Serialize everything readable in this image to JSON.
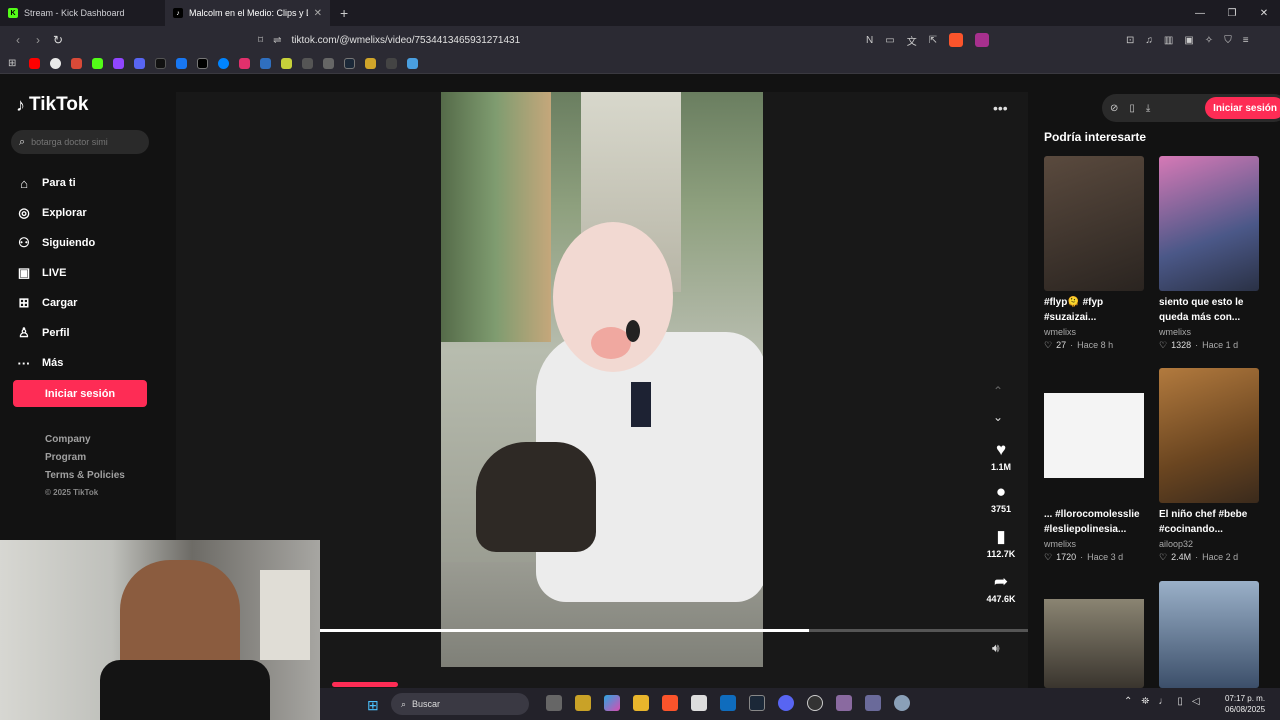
{
  "browser": {
    "tabs": [
      {
        "title": "Stream - Kick Dashboard",
        "favicon": "K",
        "favicon_color": "#53fc18"
      },
      {
        "title": "Malcolm en el Medio: Clips y Dr",
        "favicon": "♪",
        "favicon_color": "#000000"
      }
    ],
    "new_tab": "+",
    "url": "tiktok.com/@wmelixs/video/7534413465931271431"
  },
  "tiktok": {
    "logo": "TikTok",
    "search_placeholder": "botarga doctor simi",
    "nav": [
      {
        "label": "Para ti",
        "icon": "home-icon",
        "glyph": "⌂"
      },
      {
        "label": "Explorar",
        "icon": "compass-icon",
        "glyph": "◎"
      },
      {
        "label": "Siguiendo",
        "icon": "following-icon",
        "glyph": "⚇"
      },
      {
        "label": "LIVE",
        "icon": "live-icon",
        "glyph": "▣"
      },
      {
        "label": "Cargar",
        "icon": "upload-icon",
        "glyph": "⊞"
      },
      {
        "label": "Perfil",
        "icon": "profile-icon",
        "glyph": "♙"
      },
      {
        "label": "Más",
        "icon": "more-icon",
        "glyph": "···"
      }
    ],
    "login_label": "Iniciar sesión",
    "footer": {
      "company": "Company",
      "program": "Program",
      "terms": "Terms & Policies",
      "copyright": "© 2025 TikTok"
    },
    "video": {
      "likes": "1.1M",
      "comments": "3751",
      "saves": "112.7K",
      "shares": "447.6K",
      "progress": 0.69
    },
    "top_login_label": "Iniciar sesión",
    "recommend_title": "Podría interesarte",
    "cards": [
      {
        "caption": "#flyp🫠 #fyp\n#suzaizai...",
        "user": "wmelixs",
        "likes": "27",
        "age": "Hace 8 h",
        "color": "#3b332c"
      },
      {
        "caption": "siento que esto le\nqueda más con...",
        "user": "wmelixs",
        "likes": "1328",
        "age": "Hace 1 d",
        "color": "#6b6d8f"
      },
      {
        "caption": "... #llorocomolesslie\n#lesliepolinesia...",
        "user": "wmelixs",
        "likes": "1720",
        "age": "Hace 3 d",
        "color": "#f2f2f2"
      },
      {
        "caption": "El niño chef #bebe\n#cocinando...",
        "user": "ailoop32",
        "likes": "2.4M",
        "age": "Hace 2 d",
        "color": "#8a5b2c"
      },
      {
        "caption": "",
        "user": "",
        "likes": "",
        "age": "",
        "color": "#6e6a5e"
      },
      {
        "caption": "",
        "user": "",
        "likes": "",
        "age": "",
        "color": "#5d7590"
      }
    ]
  },
  "taskbar": {
    "search_label": "Buscar",
    "time": "07:17 p. m.",
    "date": "06/08/2025"
  }
}
